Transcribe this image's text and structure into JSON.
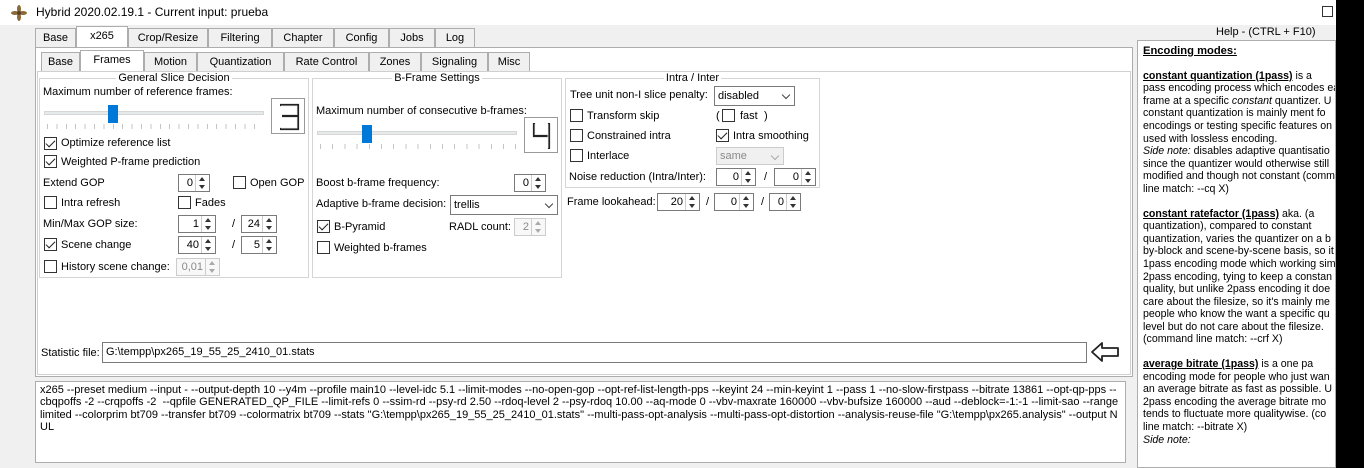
{
  "window": {
    "title": "Hybrid 2020.02.19.1 - Current input: prueba"
  },
  "main_tabs": [
    "Base",
    "x265",
    "Crop/Resize",
    "Filtering",
    "Chapter",
    "Config",
    "Jobs",
    "Log"
  ],
  "active_main_tab": "x265",
  "sub_tabs": [
    "Base",
    "Frames",
    "Motion",
    "Quantization",
    "Rate Control",
    "Zones",
    "Signaling",
    "Misc"
  ],
  "active_sub_tab": "Frames",
  "gsd": {
    "title": "General Slice Decision",
    "max_ref_label": "Maximum number of reference frames:",
    "max_ref_value": "3",
    "max_ref_slider_level": 0.3125,
    "optimize_ref_list": "Optimize reference list",
    "weighted_p": "Weighted P-frame prediction",
    "extend_gop": "Extend GOP",
    "extend_gop_value": "0",
    "open_gop": "Open GOP",
    "intra_refresh": "Intra refresh",
    "fades": "Fades",
    "min_max_gop": "Min/Max GOP size:",
    "min_gop": "1",
    "max_gop": "24",
    "scene_change": "Scene change",
    "scene_change_value": "40",
    "scene_change_value2": "5",
    "history_scene_change": "History scene change:",
    "history_value": "0,01",
    "slash": "/"
  },
  "bframe": {
    "title": "B-Frame Settings",
    "max_consec_label": "Maximum number of consecutive b-frames:",
    "max_consec_value": "4",
    "max_consec_slider_level": 0.25,
    "boost_label": "Boost b-frame frequency:",
    "boost_value": "0",
    "adaptive_label": "Adaptive b-frame decision:",
    "adaptive_value": "trellis",
    "b_pyramid": "B-Pyramid",
    "radl_label": "RADL count:",
    "radl_value": "2",
    "weighted_b": "Weighted b-frames"
  },
  "intra": {
    "title": "Intra / Inter",
    "tree_unit_label": "Tree unit non-I slice penalty:",
    "tree_unit_value": "disabled",
    "transform_skip": "Transform skip",
    "fast_open": "(",
    "fast": "fast",
    "fast_close": ")",
    "constrained_intra": "Constrained intra",
    "intra_smoothing": "Intra smoothing",
    "interlace": "Interlace",
    "interlace_value": "same",
    "noise_label": "Noise reduction (Intra/Inter):",
    "noise_intra": "0",
    "noise_inter": "0",
    "slash": "/"
  },
  "lookahead": {
    "label": "Frame lookahead:",
    "v1": "20",
    "v2": "0",
    "v3": "0",
    "slash": "/"
  },
  "stat_file": {
    "label": "Statistic file:",
    "value": "G:\\tempp\\px265_19_55_25_2410_01.stats"
  },
  "command_line": "x265 --preset medium --input - --output-depth 10 --y4m --profile main10 --level-idc 5.1 --limit-modes --no-open-gop --opt-ref-list-length-pps --keyint 24 --min-keyint 1 --pass 1 --no-slow-firstpass --bitrate 13861 --opt-qp-pps --cbqpoffs -2 --crqpoffs -2  --qpfile GENERATED_QP_FILE --limit-refs 0 --ssim-rd --psy-rd 2.50 --rdoq-level 2 --psy-rdoq 10.00 --aq-mode 0 --vbv-maxrate 160000 --vbv-bufsize 160000 --aud --deblock=-1:-1 --limit-sao --range limited --colorprim bt709 --transfer bt709 --colormatrix bt709 --stats \"G:\\tempp\\px265_19_55_25_2410_01.stats\" --multi-pass-opt-analysis --multi-pass-opt-distortion --analysis-reuse-file \"G:\\tempp\\px265.analysis\" --output NUL",
  "help": {
    "title": "Help - (CTRL + F10)",
    "heading": "Encoding modes:",
    "cq_title": "constant quantization (1pass)",
    "cq_lines": [
      " is a",
      "pass encoding process which encodes ea",
      "frame at a specific ",
      "constant quantization is mainly ment fo",
      "encodings or testing specific features on",
      "used with lossless encoding."
    ],
    "cq_italic": "constant",
    "cq_after_italic": " quantizer. U",
    "side_note": "Side note:",
    "cq_note_lines": [
      "  disables adaptive quantisatio",
      "since the quantizer would otherwise still",
      "modified and though not constant (comm",
      "line match: --cq X)"
    ],
    "crf_title": "constant ratefactor (1pass)",
    "crf_lines": [
      " aka. (a",
      "quantization), compared to constant",
      "quantization, varies the quantizer on a b",
      "by-block and scene-by-scene basis, so it",
      "1pass encoding mode which working sim",
      "2pass encoding, tying to keep a constan",
      "quality, but unlike 2pass encoding it doe",
      "care about the filesize, so it's mainly me",
      "people who know the want a specific qu",
      "level but do not care about the filesize.",
      "(command line match: --crf X)"
    ],
    "abr_title": "average bitrate (1pass)",
    "abr_lines": [
      " is a one pa",
      "encoding mode for people who just wan",
      "an average bitrate as fast as possible. U",
      "2pass encoding the average bitrate mo",
      "tends to fluctuate more qualitywise. (co",
      "line match: --bitrate X)"
    ],
    "side_note2": "Side note:"
  }
}
